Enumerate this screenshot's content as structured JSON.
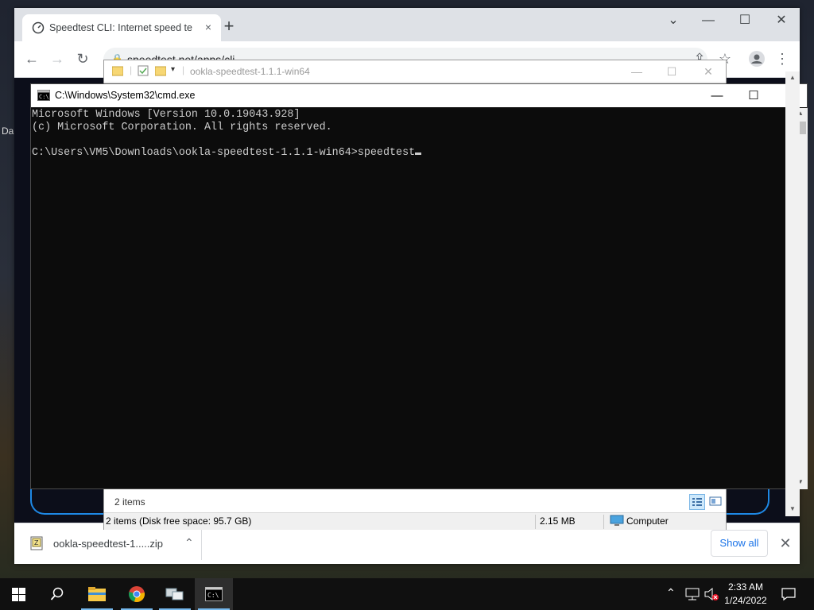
{
  "desktop": {
    "partial_label": "Da"
  },
  "chrome": {
    "tab_title": "Speedtest CLI: Internet speed tes",
    "tab_close": "×",
    "new_tab": "+",
    "url": "speedtest.net/apps/cli",
    "download": {
      "filename": "ookla-speedtest-1.....zip",
      "show_all": "Show all",
      "close": "✕"
    }
  },
  "explorer": {
    "title": "ookla-speedtest-1.1.1-win64",
    "items_count": "2 items",
    "status_details": "2 items (Disk free space: 95.7 GB)",
    "status_size": "2.15 MB",
    "status_location": "Computer"
  },
  "cmd": {
    "title": "C:\\Windows\\System32\\cmd.exe",
    "lines": [
      "Microsoft Windows [Version 10.0.19043.928]",
      "(c) Microsoft Corporation. All rights reserved.",
      "",
      "C:\\Users\\VM5\\Downloads\\ookla-speedtest-1.1.1-win64>speedtest"
    ]
  },
  "taskbar": {
    "time": "2:33 AM",
    "date": "1/24/2022"
  },
  "colors": {
    "cmd_bg": "#0c0c0c",
    "cmd_text": "#cccccc",
    "chrome_link": "#1a73e8",
    "taskbar_bg": "#101010",
    "taskbar_accent": "#76b9ed"
  }
}
